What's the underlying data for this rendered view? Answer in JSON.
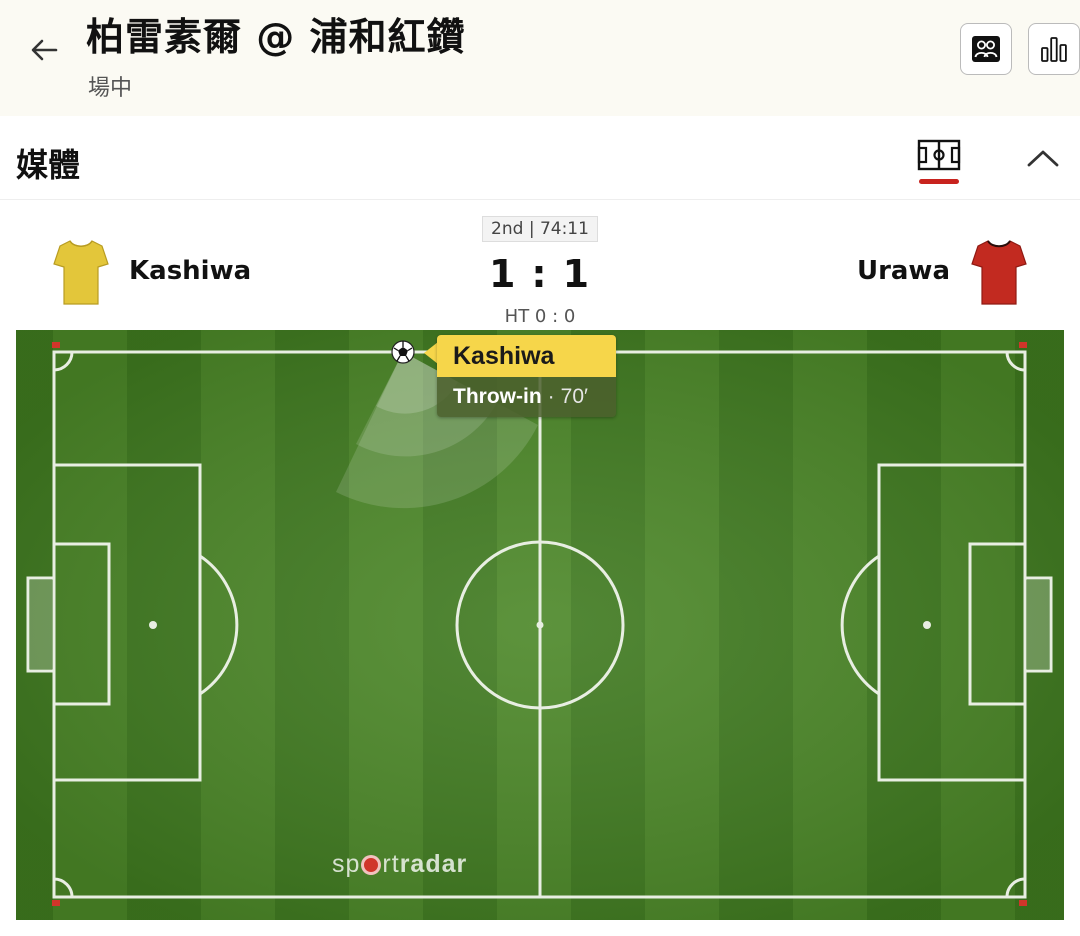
{
  "header": {
    "title": "柏雷素爾 @ 浦和紅鑽",
    "subtitle": "場中",
    "back_icon": "arrow-left-icon",
    "lineup_icon": "lineup-icon",
    "stats_icon": "bar-chart-icon"
  },
  "media": {
    "title": "媒體",
    "field_icon": "pitch-icon",
    "collapse_icon": "chevron-up-icon",
    "active_color": "#c8231e"
  },
  "match": {
    "period": "2nd | 74:11",
    "home": {
      "name": "Kashiwa",
      "jersey_color": "#e3c63a",
      "score": "1"
    },
    "away": {
      "name": "Urawa",
      "jersey_color": "#c22a20",
      "score": "1"
    },
    "separator": ":",
    "halftime": "HT 0 : 0"
  },
  "event": {
    "team": "Kashiwa",
    "type": "Throw-in",
    "dot": "·",
    "minute": "70′"
  },
  "brand": {
    "pre": "sp",
    "mid": "rt",
    "bold": "radar"
  },
  "colors": {
    "grass_dark": "#3f7a1f",
    "grass_light": "#4d8a29",
    "tooltip": "#f6d64a"
  }
}
